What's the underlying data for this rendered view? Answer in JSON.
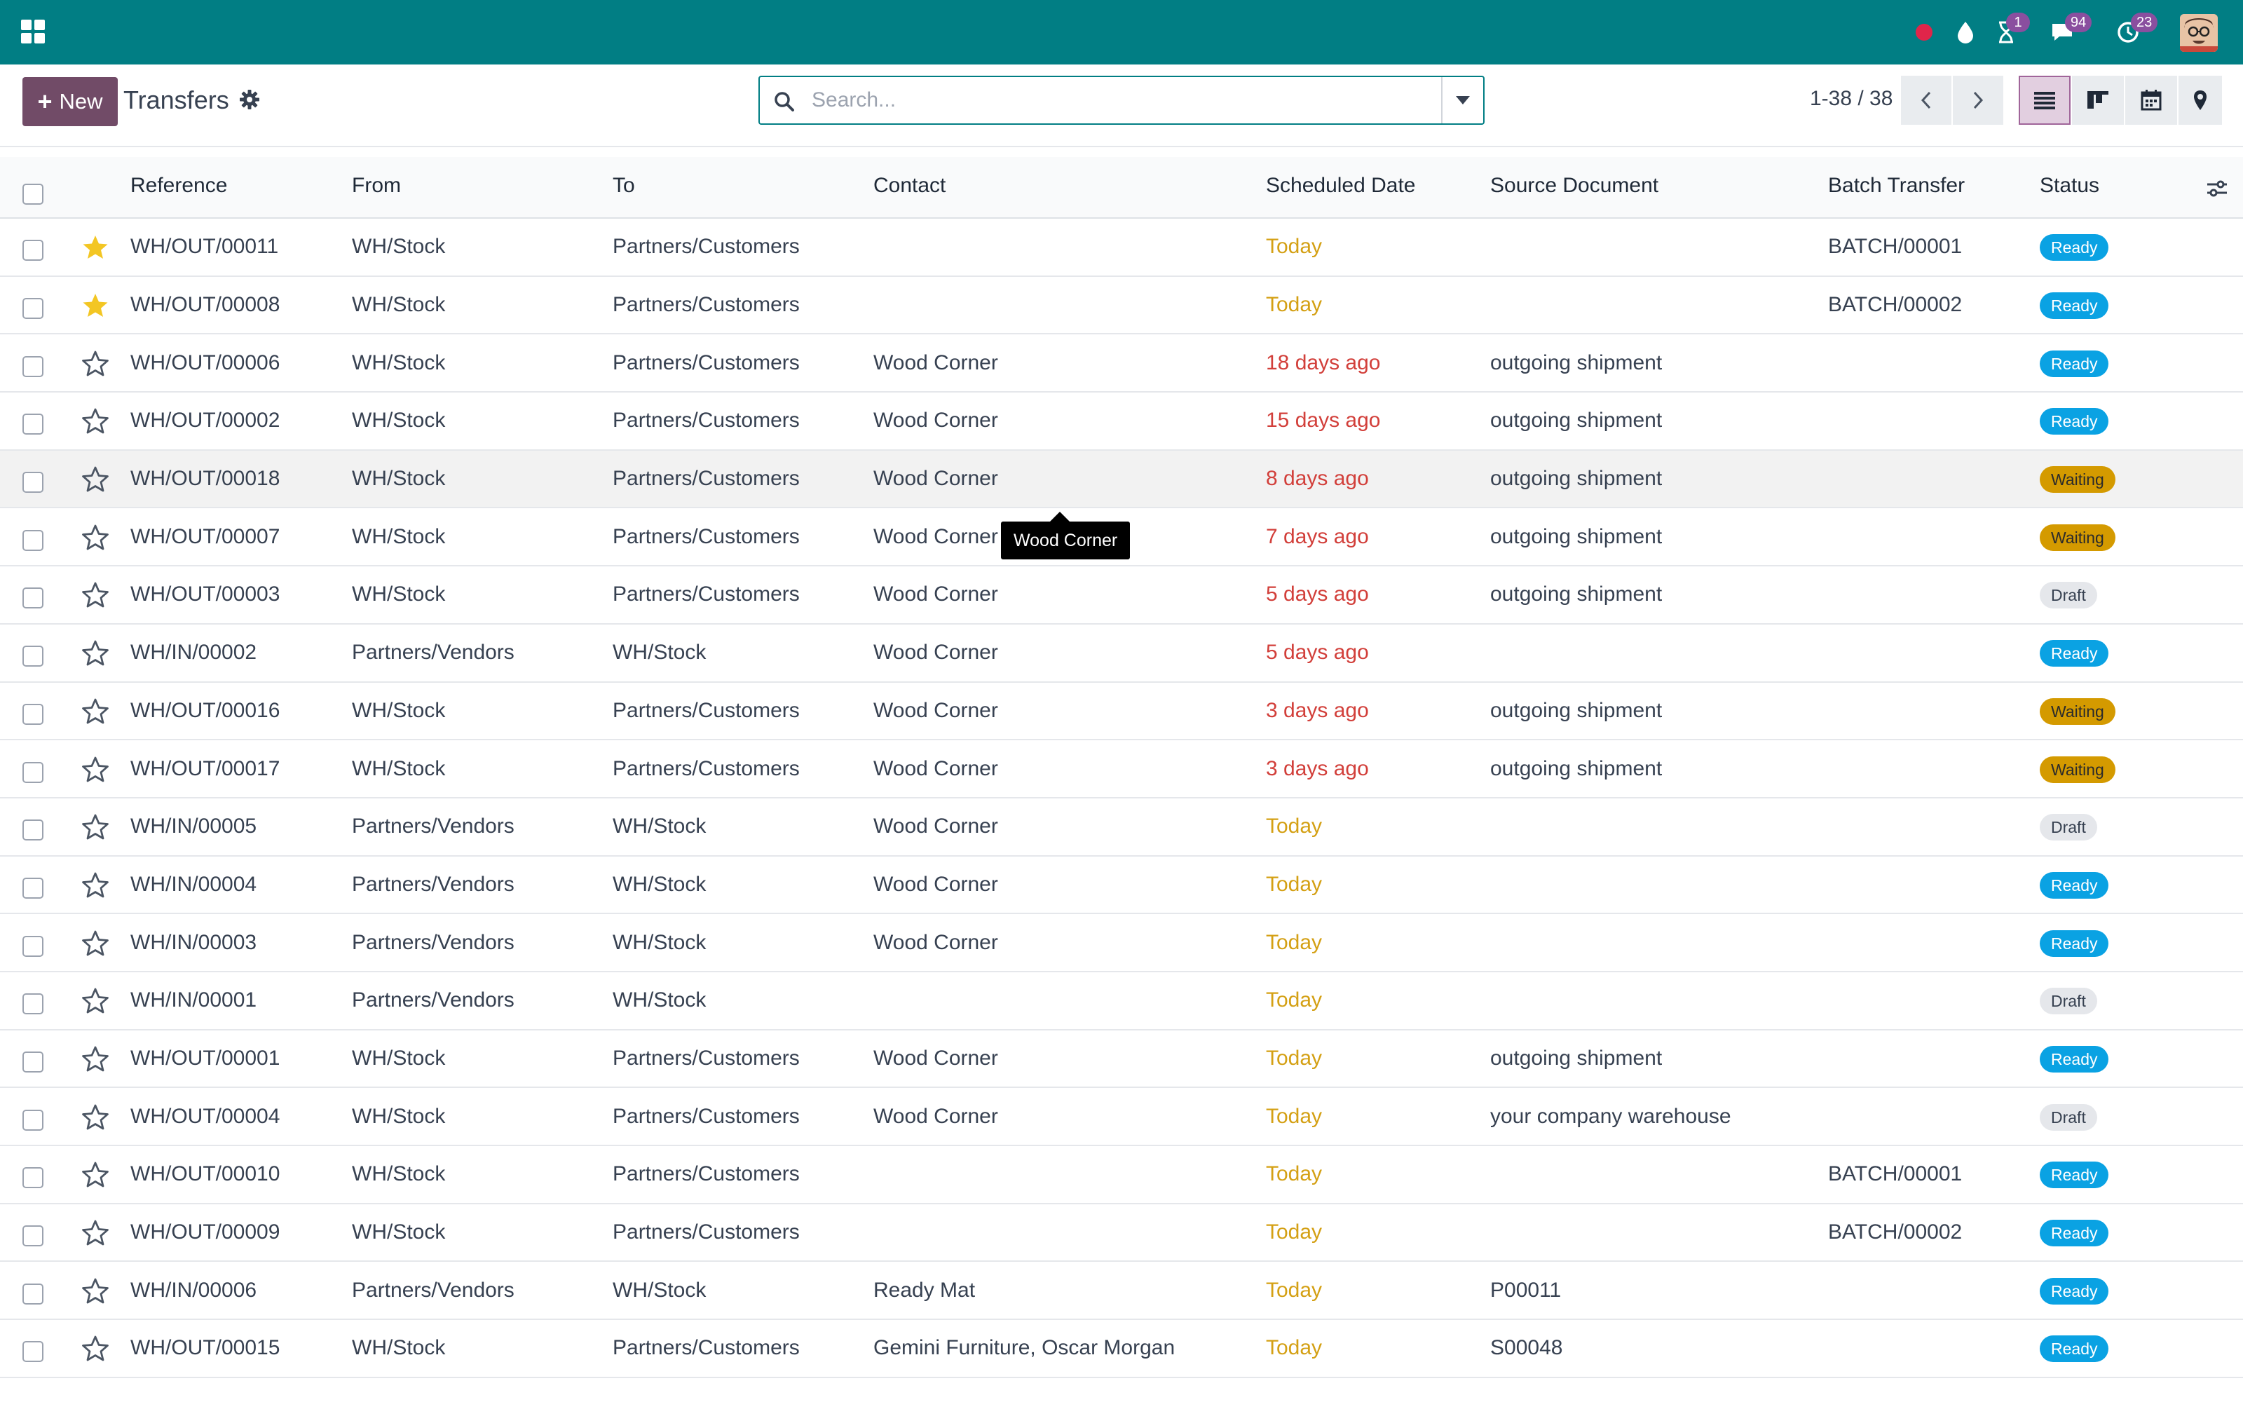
{
  "navbar": {
    "apps_icon": "apps-grid-icon",
    "icons": {
      "record": "record-dot-icon",
      "droplet": "droplet-icon",
      "activity": "hourglass-icon",
      "messages": "chat-icon",
      "timer": "clock-icon"
    },
    "badges": {
      "activity": "1",
      "messages": "94",
      "timer": "23"
    },
    "brand_color": "#017e84"
  },
  "control": {
    "new_label": "New",
    "title": "Transfers",
    "search_placeholder": "Search...",
    "pager": "1-38 / 38",
    "views": [
      "list",
      "kanban",
      "calendar",
      "map"
    ],
    "active_view": "list"
  },
  "table": {
    "columns": [
      "Reference",
      "From",
      "To",
      "Contact",
      "Scheduled Date",
      "Source Document",
      "Batch Transfer",
      "Status"
    ],
    "rows": [
      {
        "starred": true,
        "reference": "WH/OUT/00011",
        "from": "WH/Stock",
        "to": "Partners/Customers",
        "contact": "",
        "date": "Today",
        "date_state": "today",
        "source": "",
        "batch": "BATCH/00001",
        "status": "Ready",
        "status_kind": "ready"
      },
      {
        "starred": true,
        "reference": "WH/OUT/00008",
        "from": "WH/Stock",
        "to": "Partners/Customers",
        "contact": "",
        "date": "Today",
        "date_state": "today",
        "source": "",
        "batch": "BATCH/00002",
        "status": "Ready",
        "status_kind": "ready"
      },
      {
        "starred": false,
        "reference": "WH/OUT/00006",
        "from": "WH/Stock",
        "to": "Partners/Customers",
        "contact": "Wood Corner",
        "date": "18 days ago",
        "date_state": "late",
        "source": "outgoing shipment",
        "batch": "",
        "status": "Ready",
        "status_kind": "ready"
      },
      {
        "starred": false,
        "reference": "WH/OUT/00002",
        "from": "WH/Stock",
        "to": "Partners/Customers",
        "contact": "Wood Corner",
        "date": "15 days ago",
        "date_state": "late",
        "source": "outgoing shipment",
        "batch": "",
        "status": "Ready",
        "status_kind": "ready"
      },
      {
        "starred": false,
        "reference": "WH/OUT/00018",
        "from": "WH/Stock",
        "to": "Partners/Customers",
        "contact": "Wood Corner",
        "date": "8 days ago",
        "date_state": "late",
        "source": "outgoing shipment",
        "batch": "",
        "status": "Waiting",
        "status_kind": "waiting"
      },
      {
        "starred": false,
        "reference": "WH/OUT/00007",
        "from": "WH/Stock",
        "to": "Partners/Customers",
        "contact": "Wood Corner",
        "date": "7 days ago",
        "date_state": "late",
        "source": "outgoing shipment",
        "batch": "",
        "status": "Waiting",
        "status_kind": "waiting"
      },
      {
        "starred": false,
        "reference": "WH/OUT/00003",
        "from": "WH/Stock",
        "to": "Partners/Customers",
        "contact": "Wood Corner",
        "date": "5 days ago",
        "date_state": "late",
        "source": "outgoing shipment",
        "batch": "",
        "status": "Draft",
        "status_kind": "draft"
      },
      {
        "starred": false,
        "reference": "WH/IN/00002",
        "from": "Partners/Vendors",
        "to": "WH/Stock",
        "contact": "Wood Corner",
        "date": "5 days ago",
        "date_state": "late",
        "source": "",
        "batch": "",
        "status": "Ready",
        "status_kind": "ready"
      },
      {
        "starred": false,
        "reference": "WH/OUT/00016",
        "from": "WH/Stock",
        "to": "Partners/Customers",
        "contact": "Wood Corner",
        "date": "3 days ago",
        "date_state": "late",
        "source": "outgoing shipment",
        "batch": "",
        "status": "Waiting",
        "status_kind": "waiting"
      },
      {
        "starred": false,
        "reference": "WH/OUT/00017",
        "from": "WH/Stock",
        "to": "Partners/Customers",
        "contact": "Wood Corner",
        "date": "3 days ago",
        "date_state": "late",
        "source": "outgoing shipment",
        "batch": "",
        "status": "Waiting",
        "status_kind": "waiting"
      },
      {
        "starred": false,
        "reference": "WH/IN/00005",
        "from": "Partners/Vendors",
        "to": "WH/Stock",
        "contact": "Wood Corner",
        "date": "Today",
        "date_state": "today",
        "source": "",
        "batch": "",
        "status": "Draft",
        "status_kind": "draft"
      },
      {
        "starred": false,
        "reference": "WH/IN/00004",
        "from": "Partners/Vendors",
        "to": "WH/Stock",
        "contact": "Wood Corner",
        "date": "Today",
        "date_state": "today",
        "source": "",
        "batch": "",
        "status": "Ready",
        "status_kind": "ready"
      },
      {
        "starred": false,
        "reference": "WH/IN/00003",
        "from": "Partners/Vendors",
        "to": "WH/Stock",
        "contact": "Wood Corner",
        "date": "Today",
        "date_state": "today",
        "source": "",
        "batch": "",
        "status": "Ready",
        "status_kind": "ready"
      },
      {
        "starred": false,
        "reference": "WH/IN/00001",
        "from": "Partners/Vendors",
        "to": "WH/Stock",
        "contact": "",
        "date": "Today",
        "date_state": "today",
        "source": "",
        "batch": "",
        "status": "Draft",
        "status_kind": "draft"
      },
      {
        "starred": false,
        "reference": "WH/OUT/00001",
        "from": "WH/Stock",
        "to": "Partners/Customers",
        "contact": "Wood Corner",
        "date": "Today",
        "date_state": "today",
        "source": "outgoing shipment",
        "batch": "",
        "status": "Ready",
        "status_kind": "ready"
      },
      {
        "starred": false,
        "reference": "WH/OUT/00004",
        "from": "WH/Stock",
        "to": "Partners/Customers",
        "contact": "Wood Corner",
        "date": "Today",
        "date_state": "today",
        "source": "your company warehouse",
        "batch": "",
        "status": "Draft",
        "status_kind": "draft"
      },
      {
        "starred": false,
        "reference": "WH/OUT/00010",
        "from": "WH/Stock",
        "to": "Partners/Customers",
        "contact": "",
        "date": "Today",
        "date_state": "today",
        "source": "",
        "batch": "BATCH/00001",
        "status": "Ready",
        "status_kind": "ready"
      },
      {
        "starred": false,
        "reference": "WH/OUT/00009",
        "from": "WH/Stock",
        "to": "Partners/Customers",
        "contact": "",
        "date": "Today",
        "date_state": "today",
        "source": "",
        "batch": "BATCH/00002",
        "status": "Ready",
        "status_kind": "ready"
      },
      {
        "starred": false,
        "reference": "WH/IN/00006",
        "from": "Partners/Vendors",
        "to": "WH/Stock",
        "contact": "Ready Mat",
        "date": "Today",
        "date_state": "today",
        "source": "P00011",
        "batch": "",
        "status": "Ready",
        "status_kind": "ready"
      },
      {
        "starred": false,
        "reference": "WH/OUT/00015",
        "from": "WH/Stock",
        "to": "Partners/Customers",
        "contact": "Gemini Furniture, Oscar Morgan",
        "date": "Today",
        "date_state": "today",
        "source": "S00048",
        "batch": "",
        "status": "Ready",
        "status_kind": "ready"
      }
    ],
    "hovered_row": 4
  },
  "tooltip": {
    "text": "Wood Corner"
  },
  "colors": {
    "accent": "#714b67",
    "ready": "#0aa2e3",
    "waiting": "#d49a00",
    "draft": "#e5e7eb",
    "today": "#d4a014",
    "late": "#d23f3a",
    "star": "#f3c623"
  }
}
